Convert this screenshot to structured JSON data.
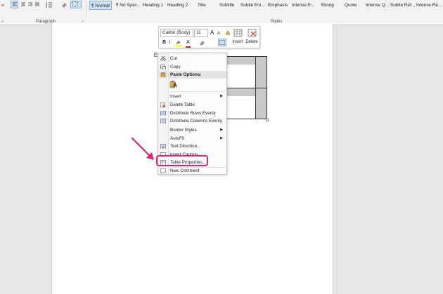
{
  "ribbon": {
    "styles": [
      "¶ Normal",
      "¶ No Spac...",
      "Heading 1",
      "Heading 2",
      "Title",
      "Subtitle",
      "Subtle Em...",
      "Emphasis",
      "Intense E...",
      "Strong",
      "Quote",
      "Intense Q...",
      "Subtle Ref...",
      "Intense Re..."
    ],
    "paragraph_label": "Paragraph",
    "styles_label": "Styles"
  },
  "mini_toolbar": {
    "font_name": "Calibri (Body)",
    "font_size": "11",
    "bold": "B",
    "italic": "I",
    "font_color_letter": "A",
    "grow_font": "A",
    "shrink_font": "A",
    "insert_label": "Insert",
    "delete_label": "Delete"
  },
  "context_menu": {
    "items": [
      {
        "label": "Cut",
        "icon": "scissors-icon"
      },
      {
        "label": "Copy",
        "icon": "copy-icon"
      },
      {
        "label": "Paste Options:",
        "icon": "paste-icon"
      },
      {
        "label": "Insert",
        "icon": "",
        "submenu": "▶"
      },
      {
        "label": "Delete Table",
        "icon": "delete-table-icon"
      },
      {
        "label": "Distribute Rows Evenly",
        "icon": "distribute-rows-icon"
      },
      {
        "label": "Distribute Columns Evenly",
        "icon": "distribute-columns-icon"
      },
      {
        "label": "Border Styles",
        "icon": "",
        "submenu": "▶"
      },
      {
        "label": "AutoFit",
        "icon": "",
        "submenu": "▶"
      },
      {
        "label": "Text Direction...",
        "icon": "text-direction-icon"
      },
      {
        "label": "Insert Caption...",
        "icon": "insert-caption-icon"
      },
      {
        "label": "Table Properties...",
        "icon": "table-properties-icon"
      },
      {
        "label": "New Comment",
        "icon": "new-comment-icon"
      }
    ],
    "paste_keep_text": "A"
  },
  "colors": {
    "highlight": "#d3267b",
    "arrow": "#d3267b",
    "accent": "#2b579a"
  }
}
